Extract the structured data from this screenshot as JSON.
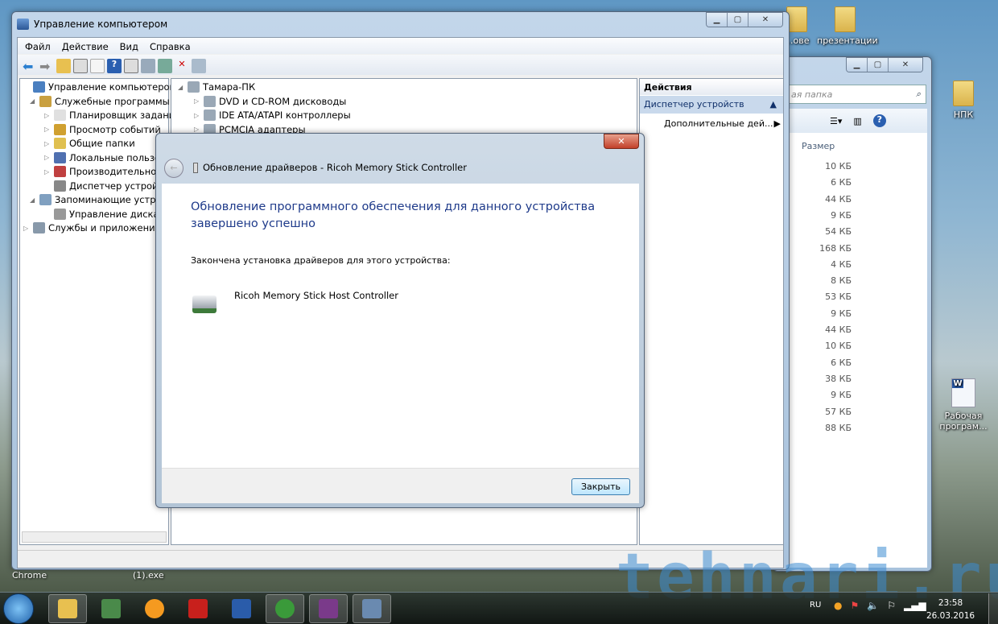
{
  "desktop": {
    "icons": [
      {
        "label": "…ове"
      },
      {
        "label": "презентации"
      },
      {
        "label": "НПК"
      },
      {
        "label": "Рабочая програм..."
      },
      {
        "label": "Chrome"
      },
      {
        "label": "(1).exe"
      }
    ],
    "watermark": "tehnari.ru"
  },
  "mmc": {
    "title": "Управление компьютером",
    "menu": [
      "Файл",
      "Действие",
      "Вид",
      "Справка"
    ],
    "tree": [
      {
        "label": "Управление компьютером (л"
      },
      {
        "label": "Служебные программы"
      },
      {
        "label": "Планировщик заданий"
      },
      {
        "label": "Просмотр событий"
      },
      {
        "label": "Общие папки"
      },
      {
        "label": "Локальные пользова"
      },
      {
        "label": "Производительность"
      },
      {
        "label": "Диспетчер устройств"
      },
      {
        "label": "Запоминающие устрой"
      },
      {
        "label": "Управление дисками"
      },
      {
        "label": "Службы и приложения"
      }
    ],
    "devices": [
      {
        "label": "Тамара-ПК"
      },
      {
        "label": "DVD и CD-ROM дисководы"
      },
      {
        "label": "IDE ATA/ATAPI контроллеры"
      },
      {
        "label": "PCMCIA адаптеры"
      }
    ],
    "actions": {
      "header": "Действия",
      "section": "Диспетчер устройств",
      "item": "Дополнительные дей..."
    }
  },
  "explorer": {
    "search_placeholder": "ая папка",
    "column": "Размер",
    "sizes": [
      "10 КБ",
      "6 КБ",
      "44 КБ",
      "9 КБ",
      "54 КБ",
      "168 КБ",
      "4 КБ",
      "8 КБ",
      "53 КБ",
      "9 КБ",
      "44 КБ",
      "10 КБ",
      "6 КБ",
      "38 КБ",
      "9 КБ",
      "57 КБ",
      "88 КБ"
    ]
  },
  "dialog": {
    "title": "Обновление драйверов - Ricoh Memory Stick Controller",
    "heading": "Обновление программного обеспечения для данного устройства завершено успешно",
    "message": "Закончена установка драйверов для этого устройства:",
    "device": "Ricoh Memory Stick Host Controller",
    "close_label": "Закрыть",
    "heading_color": "#1e3a8a"
  },
  "taskbar": {
    "apps": [
      "explorer",
      "device-manager",
      "media-player",
      "acrobat",
      "word",
      "chrome",
      "winrar",
      "computer-management"
    ],
    "lang": "RU",
    "time": "23:58",
    "date": "26.03.2016"
  }
}
